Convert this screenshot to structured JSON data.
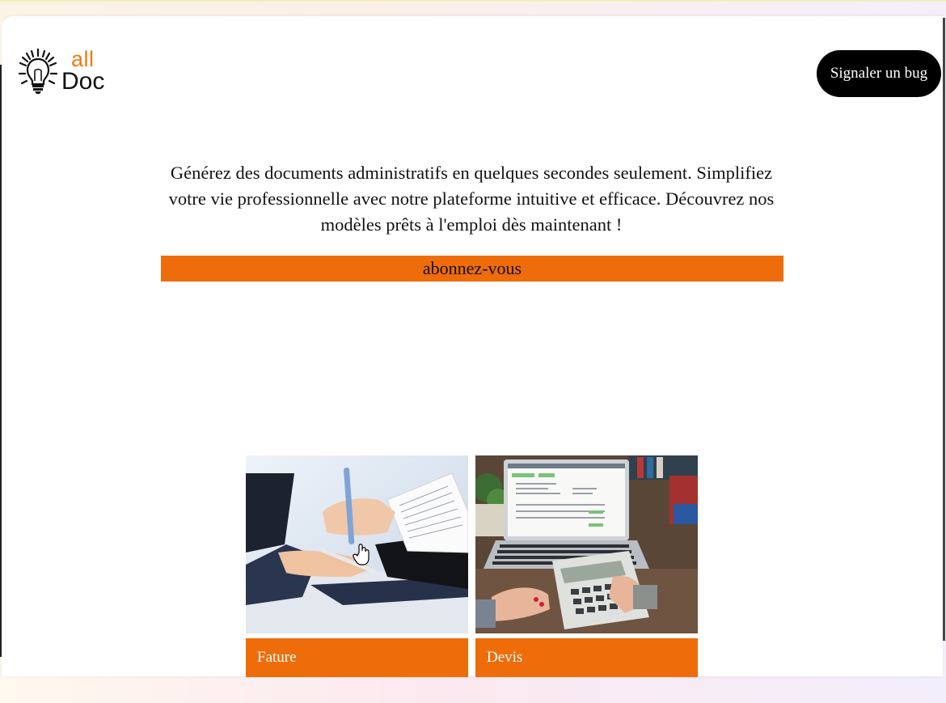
{
  "header": {
    "logo": {
      "word_top": "all",
      "word_bottom": "Doc",
      "icon": "lightbulb-logo-icon",
      "accent_color": "#ef7a12"
    },
    "bug_button_label": "Signaler un bug"
  },
  "hero": {
    "description": "Générez des documents administratifs en quelques secondes seulement. Simplifiez votre vie professionnelle avec notre plateforme intuitive et efficace. Découvrez nos modèles prêts à l'emploi dès maintenant !",
    "subscribe_label": "abonnez-vous"
  },
  "documents": [
    {
      "label": "Fature",
      "image": "handshake-paperwork-photo"
    },
    {
      "label": "Devis",
      "image": "laptop-calculator-photo"
    }
  ],
  "colors": {
    "accent": "#ef6c0a",
    "button_dark": "#000000"
  }
}
